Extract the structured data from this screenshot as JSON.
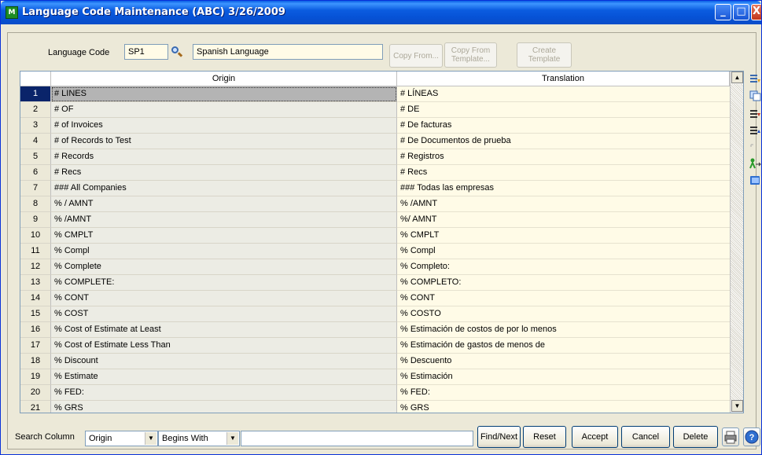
{
  "window": {
    "title": "Language Code Maintenance (ABC) 3/26/2009",
    "app_icon_text": "M",
    "minimize": "_",
    "maximize": "□",
    "close": "X"
  },
  "header": {
    "language_code_label": "Language Code",
    "language_code_value": "SP1",
    "description_value": "Spanish Language",
    "copy_from_label": "Copy From...",
    "copy_from_template_label": "Copy From Template...",
    "create_template_label": "Create Template"
  },
  "grid": {
    "columns": [
      "Origin",
      "Translation"
    ],
    "selected_row": 1,
    "rows": [
      {
        "n": "1",
        "origin": "# LINES",
        "translation": "# LÍNEAS"
      },
      {
        "n": "2",
        "origin": "# OF",
        "translation": "# DE"
      },
      {
        "n": "3",
        "origin": "# of Invoices",
        "translation": "# De facturas"
      },
      {
        "n": "4",
        "origin": "# of Records to Test",
        "translation": "# De Documentos de prueba"
      },
      {
        "n": "5",
        "origin": "# Records",
        "translation": "# Registros"
      },
      {
        "n": "6",
        "origin": "# Recs",
        "translation": "# Recs"
      },
      {
        "n": "7",
        "origin": "### All Companies",
        "translation": "### Todas las empresas"
      },
      {
        "n": "8",
        "origin": "% / AMNT",
        "translation": "% /AMNT"
      },
      {
        "n": "9",
        "origin": "% /AMNT",
        "translation": "%/ AMNT"
      },
      {
        "n": "10",
        "origin": "% CMPLT",
        "translation": "% CMPLT"
      },
      {
        "n": "11",
        "origin": "% Compl",
        "translation": "% Compl"
      },
      {
        "n": "12",
        "origin": "% Complete",
        "translation": "% Completo:"
      },
      {
        "n": "13",
        "origin": "% COMPLETE:",
        "translation": "% COMPLETO:"
      },
      {
        "n": "14",
        "origin": "% CONT",
        "translation": "% CONT"
      },
      {
        "n": "15",
        "origin": "% COST",
        "translation": "% COSTO"
      },
      {
        "n": "16",
        "origin": "% Cost of Estimate at Least",
        "translation": "% Estimación de costos de por lo menos"
      },
      {
        "n": "17",
        "origin": "% Cost of Estimate Less Than",
        "translation": "% Estimación de gastos de menos de"
      },
      {
        "n": "18",
        "origin": "% Discount",
        "translation": "% Descuento"
      },
      {
        "n": "19",
        "origin": "% Estimate",
        "translation": "% Estimación"
      },
      {
        "n": "20",
        "origin": "% FED:",
        "translation": "% FED:"
      },
      {
        "n": "21",
        "origin": "% GRS",
        "translation": "% GRS"
      }
    ]
  },
  "footer": {
    "search_column_label": "Search Column",
    "search_column_value": "Origin",
    "search_mode_value": "Begins With",
    "search_text_value": "",
    "find_next_label": "Find/Next",
    "reset_label": "Reset",
    "accept_label": "Accept",
    "cancel_label": "Cancel",
    "delete_label": "Delete"
  },
  "side_toolbar_icons": [
    "insert-row-icon",
    "copy-row-icon",
    "move-down-icon",
    "move-up-icon",
    "blank-icon",
    "user-transfer-icon",
    "folder-icon"
  ],
  "colors": {
    "titlebar": "#0a5fe4",
    "selection": "#0a246a",
    "translation_bg": "#fffbe7",
    "origin_bg": "#ecece4"
  }
}
